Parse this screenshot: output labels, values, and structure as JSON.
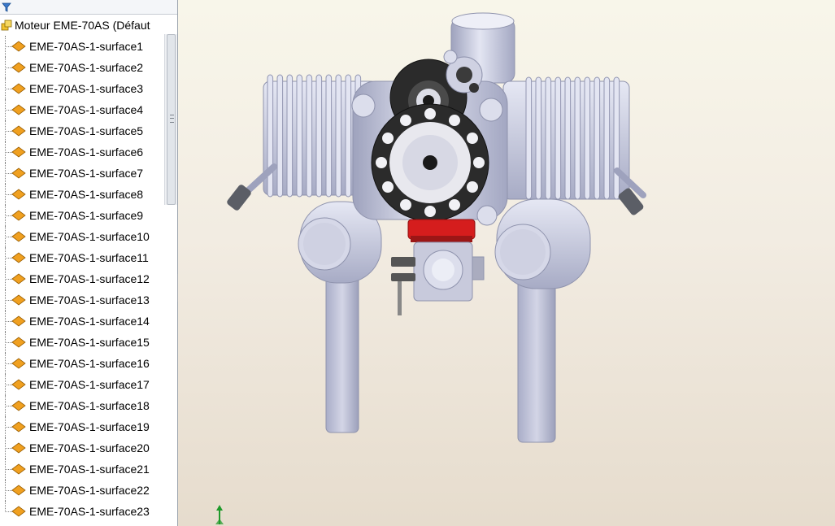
{
  "tree": {
    "root_label": "Moteur EME-70AS  (Défaut",
    "items": [
      {
        "label": "EME-70AS-1-surface1"
      },
      {
        "label": "EME-70AS-1-surface2"
      },
      {
        "label": "EME-70AS-1-surface3"
      },
      {
        "label": "EME-70AS-1-surface4"
      },
      {
        "label": "EME-70AS-1-surface5"
      },
      {
        "label": "EME-70AS-1-surface6"
      },
      {
        "label": "EME-70AS-1-surface7"
      },
      {
        "label": "EME-70AS-1-surface8"
      },
      {
        "label": "EME-70AS-1-surface9"
      },
      {
        "label": "EME-70AS-1-surface10"
      },
      {
        "label": "EME-70AS-1-surface11"
      },
      {
        "label": "EME-70AS-1-surface12"
      },
      {
        "label": "EME-70AS-1-surface13"
      },
      {
        "label": "EME-70AS-1-surface14"
      },
      {
        "label": "EME-70AS-1-surface15"
      },
      {
        "label": "EME-70AS-1-surface16"
      },
      {
        "label": "EME-70AS-1-surface17"
      },
      {
        "label": "EME-70AS-1-surface18"
      },
      {
        "label": "EME-70AS-1-surface19"
      },
      {
        "label": "EME-70AS-1-surface20"
      },
      {
        "label": "EME-70AS-1-surface21"
      },
      {
        "label": "EME-70AS-1-surface22"
      },
      {
        "label": "EME-70AS-1-surface23"
      }
    ]
  },
  "icons": {
    "filter": "filter-icon",
    "root": "assembly-icon",
    "item": "surface-icon",
    "triad": "axis-triad-icon"
  },
  "colors": {
    "surface_icon": "#f0a020",
    "engine_metal": "#c9ccdd",
    "pulley": "#2b2b2b",
    "carb_cover": "#d51d1d",
    "viewport_top": "#f8f6ea",
    "viewport_bottom": "#e6dccd"
  }
}
